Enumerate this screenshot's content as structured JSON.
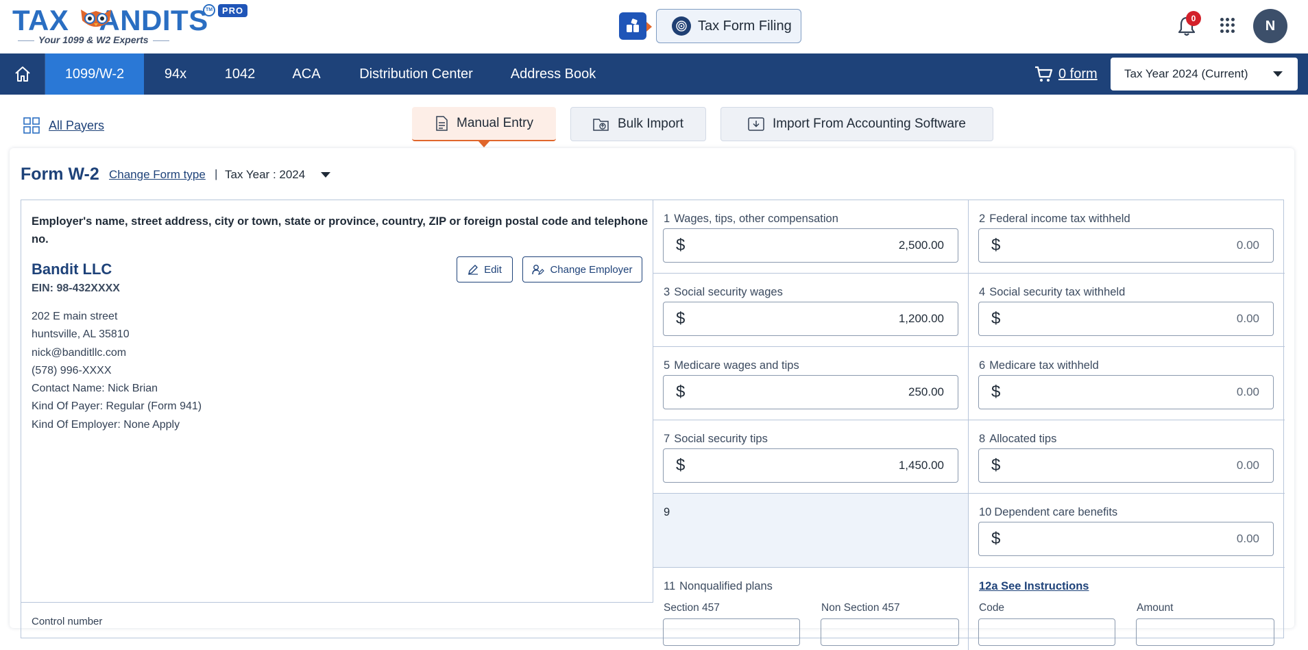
{
  "header": {
    "logo_text": "TAX",
    "logo_text_2": "ANDITS",
    "logo_trademark": "TM",
    "logo_badge": "PRO",
    "logo_tagline": "Your 1099 & W2 Experts",
    "product_button": "Tax Form Filing",
    "notification_count": "0",
    "avatar_initial": "N"
  },
  "nav": {
    "items": [
      {
        "label": "1099/W-2",
        "active": true
      },
      {
        "label": "94x"
      },
      {
        "label": "1042"
      },
      {
        "label": "ACA"
      },
      {
        "label": "Distribution Center"
      },
      {
        "label": "Address Book"
      }
    ],
    "cart_label": "0 form",
    "tax_year_selected": "Tax Year 2024 (Current)"
  },
  "subbar": {
    "all_payers": "All Payers",
    "tabs": [
      {
        "label": "Manual Entry",
        "active": true
      },
      {
        "label": "Bulk Import"
      },
      {
        "label": "Import From Accounting Software"
      }
    ]
  },
  "form": {
    "title": "Form W-2",
    "change_form_type": "Change Form type",
    "separator": "|",
    "tax_year": "Tax Year : 2024",
    "employer": {
      "caption": "Employer's name, street address, city or town, state or province, country, ZIP or foreign postal code and telephone no.",
      "name": "Bandit LLC",
      "ein": "EIN: 98-432XXXX",
      "edit_label": "Edit",
      "change_employer_label": "Change Employer",
      "lines": [
        "202 E main street",
        "huntsville, AL 35810",
        "nick@banditllc.com",
        "(578) 996-XXXX",
        "Contact Name: Nick Brian",
        "Kind Of Payer: Regular (Form 941)",
        "Kind Of Employer: None Apply"
      ],
      "bottom_text": "Control number"
    },
    "currency_symbol": "$",
    "boxes": [
      {
        "num": "1",
        "label": "Wages, tips, other compensation",
        "value": "2,500.00"
      },
      {
        "num": "2",
        "label": "Federal income tax withheld",
        "value": "0.00"
      },
      {
        "num": "3",
        "label": "Social security wages",
        "value": "1,200.00"
      },
      {
        "num": "4",
        "label": "Social security tax withheld",
        "value": "0.00"
      },
      {
        "num": "5",
        "label": "Medicare wages and tips",
        "value": "250.00"
      },
      {
        "num": "6",
        "label": "Medicare tax withheld",
        "value": "0.00"
      },
      {
        "num": "7",
        "label": "Social security tips",
        "value": "1,450.00"
      },
      {
        "num": "8",
        "label": "Allocated tips",
        "value": "0.00"
      },
      {
        "num": "10",
        "label": "Dependent care benefits",
        "value": "0.00"
      }
    ],
    "box9": "9",
    "box11": {
      "num": "11",
      "label": "Nonqualified plans",
      "sub1": "Section 457",
      "sub2": "Non Section 457"
    },
    "box12a": {
      "label": "12a See Instructions",
      "sub1": "Code",
      "sub2": "Amount"
    }
  },
  "colors": {
    "navbar": "#1e4279",
    "nav_active": "#2a78d6",
    "accent": "#e0662b",
    "brand_blue": "#2a6ec2"
  }
}
